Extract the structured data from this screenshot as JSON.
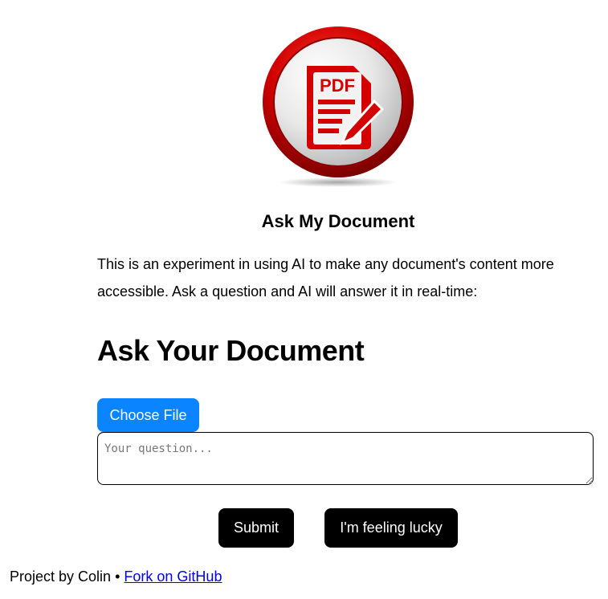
{
  "logo": {
    "label": "PDF",
    "icon": "pdf-document-edit-icon",
    "colors": {
      "ring": "#cc0000",
      "document": "#d40000",
      "background": "#e6e6e6"
    }
  },
  "app": {
    "title": "Ask My Document",
    "intro": "This is an experiment in using AI to make any document's content more accessible. Ask a question and AI will answer it in real-time:"
  },
  "form": {
    "heading": "Ask Your Document",
    "choose_file_label": "Choose File",
    "question_placeholder": "Your question...",
    "question_value": "",
    "submit_label": "Submit",
    "lucky_label": "I'm feeling lucky"
  },
  "footer": {
    "credit": "Project by Colin",
    "separator": "•",
    "github_link": "Fork on GitHub"
  },
  "colors": {
    "primary_button": "#0a84ff",
    "dark_button": "#000000",
    "link": "#0000ee"
  }
}
